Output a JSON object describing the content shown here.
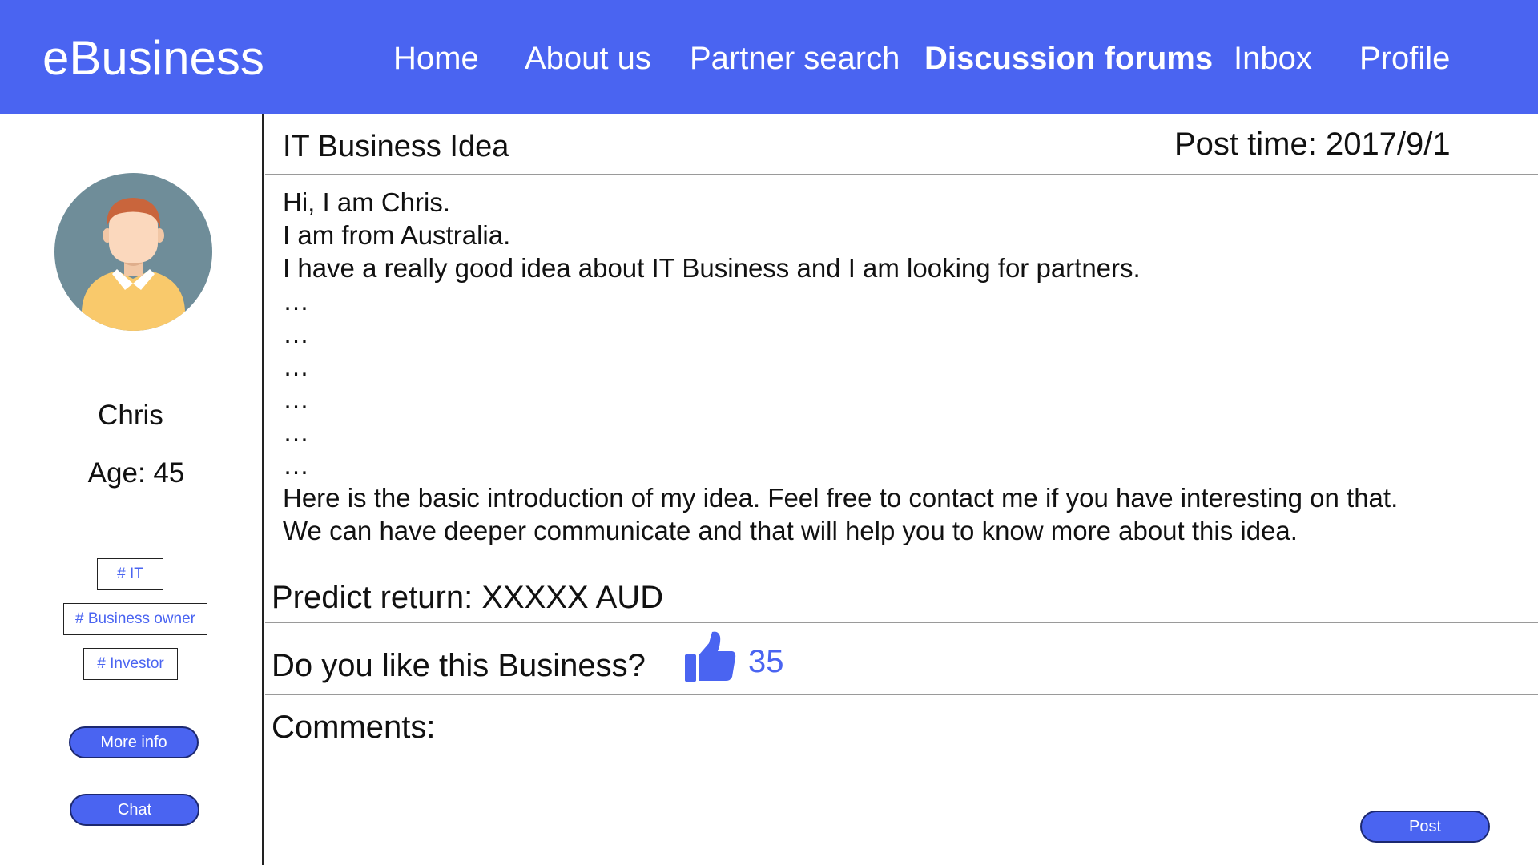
{
  "brand": "eBusiness",
  "nav": {
    "items": [
      {
        "label": "Home"
      },
      {
        "label": "About us"
      },
      {
        "label": "Partner search"
      },
      {
        "label": "Discussion forums"
      },
      {
        "label": "Inbox"
      },
      {
        "label": "Profile"
      }
    ],
    "active": "Discussion forums"
  },
  "sidebar": {
    "name": "Chris",
    "age": "Age: 45",
    "tags": [
      "# IT",
      "# Business owner",
      "# Investor"
    ],
    "more_info_label": "More info",
    "chat_label": "Chat"
  },
  "post": {
    "title": "IT Business Idea",
    "time": "Post time: 2017/9/1",
    "body": [
      "Hi,  I am Chris.",
      "I am from Australia.",
      "I have a really good idea about IT Business and I am looking for partners.",
      "…",
      "…",
      "…",
      "…",
      "…",
      "…",
      "Here is the basic introduction of my idea. Feel free to contact me if you have interesting on that.",
      "We can have deeper communicate and that will help you to know more about this idea."
    ],
    "predict_return": "Predict return: XXXXX AUD",
    "like_question": "Do you like this Business?",
    "like_count": "35",
    "comments_label": "Comments:",
    "post_button": "Post"
  },
  "colors": {
    "accent": "#4a64f1",
    "header_bg": "#4a64f1",
    "avatar_bg": "#6f8d99",
    "shirt": "#f9c96b"
  },
  "icons": {
    "like": "thumbs-up-icon",
    "avatar": "user-avatar-icon"
  }
}
